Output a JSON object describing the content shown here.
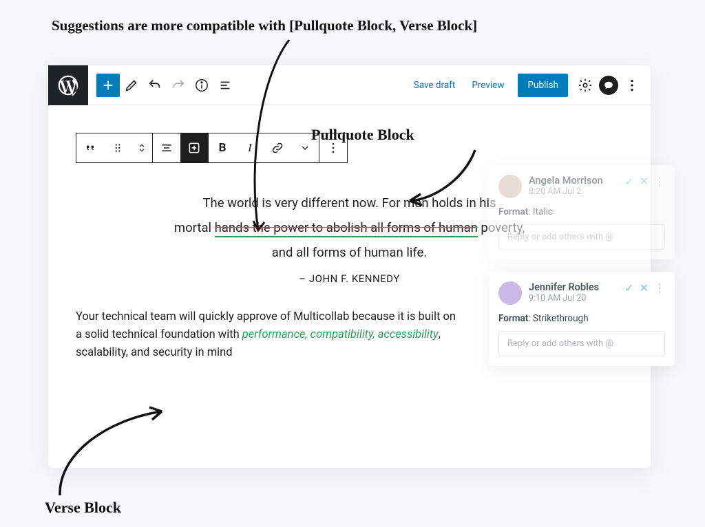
{
  "annotations": {
    "top": "Suggestions are more compatible with [Pullquote Block, Verse Block]",
    "pullquote_label": "Pullquote Block",
    "verse_label": "Verse Block"
  },
  "topbar": {
    "save_draft": "Save draft",
    "preview": "Preview",
    "publish": "Publish"
  },
  "block_toolbar": {
    "bold": "B",
    "italic": "I"
  },
  "pullquote": {
    "line1_a": "The world is very different now. For man holds in his",
    "line2_a": "mortal ",
    "line2_strike": "hands the power to abolish all forms of human",
    "line2_b": " poverty,",
    "line3": "and all forms of human life.",
    "citation": "– JOHN F. KENNEDY"
  },
  "verse": {
    "part1": "Your technical team will quickly approve of Multicollab because it is built on a solid technical foundation with ",
    "highlight": "performance, compatibility, accessibility",
    "part2": ", scalability, and security in mind"
  },
  "comments": [
    {
      "name": "Angela Morrison",
      "time": "8:20 AM Jul 2",
      "format_label": "Format",
      "format_value": ": Italic",
      "reply_placeholder": "Reply or add others with @"
    },
    {
      "name": "Jennifer Robles",
      "time": "9:10 AM Jul 20",
      "format_label": "Format",
      "format_value": ": Strikethrough",
      "reply_placeholder": "Reply or add others with @"
    }
  ]
}
